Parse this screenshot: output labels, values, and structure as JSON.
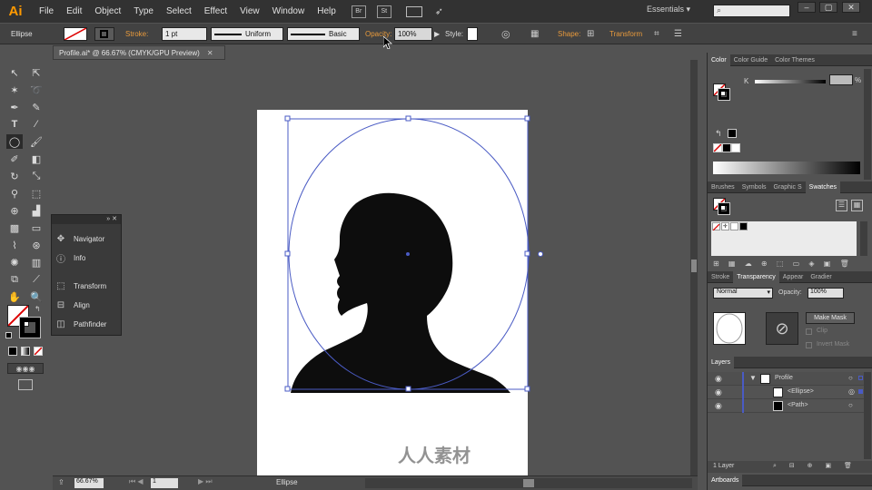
{
  "app": {
    "logo": "Ai",
    "workspace": "Essentials ▾"
  },
  "menu": [
    "File",
    "Edit",
    "Object",
    "Type",
    "Select",
    "Effect",
    "View",
    "Window",
    "Help"
  ],
  "bridge_buttons": [
    "Br",
    "St"
  ],
  "window_buttons": [
    "–",
    "▢",
    "✕"
  ],
  "control": {
    "object_type": "Ellipse",
    "stroke_label": "Stroke:",
    "stroke_weight": "1 pt",
    "profile": "Uniform",
    "brush": "Basic",
    "opacity_label": "Opacity:",
    "opacity_value": "100%",
    "style_label": "Style:",
    "shape_link": "Shape:",
    "transform_link": "Transform"
  },
  "document": {
    "tab_title": "Profile.ai* @ 66.67% (CMYK/GPU Preview)",
    "tab_close": "✕"
  },
  "status": {
    "zoom": "66.67%",
    "page": "1",
    "current_tool": "Ellipse"
  },
  "mini_panel": {
    "items": [
      {
        "label": "Navigator",
        "icon": "navigator-icon"
      },
      {
        "label": "Info",
        "icon": "info-icon"
      },
      {
        "label": "Transform",
        "icon": "transform-icon"
      },
      {
        "label": "Align",
        "icon": "align-icon"
      },
      {
        "label": "Pathfinder",
        "icon": "pathfinder-icon"
      }
    ]
  },
  "color_panel": {
    "tabs": [
      "Color",
      "Color Guide",
      "Color Themes"
    ],
    "channel_label": "K",
    "unit": "%"
  },
  "swatches_panel": {
    "tabs": [
      "Brushes",
      "Symbols",
      "Graphic S",
      "Swatches"
    ]
  },
  "transparency_panel": {
    "tabs": [
      "Stroke",
      "Transparency",
      "Appear",
      "Gradier"
    ],
    "blend_mode": "Normal",
    "opacity_label": "Opacity:",
    "opacity_value": "100%",
    "make_mask": "Make Mask",
    "clip": "Clip",
    "invert_mask": "Invert Mask"
  },
  "layers_panel": {
    "title": "Layers",
    "layers": [
      {
        "name": "Profile",
        "level": 0
      },
      {
        "name": "<Ellipse>",
        "level": 1
      },
      {
        "name": "<Path>",
        "level": 1
      }
    ],
    "footer_count": "1 Layer"
  },
  "artboards_panel": {
    "title": "Artboards"
  },
  "watermark": "人人素材",
  "colors": {
    "menubar": "#323232",
    "panel": "#535353",
    "accent_orange": "#ff9a00",
    "selection_blue": "#4a5bc4"
  }
}
